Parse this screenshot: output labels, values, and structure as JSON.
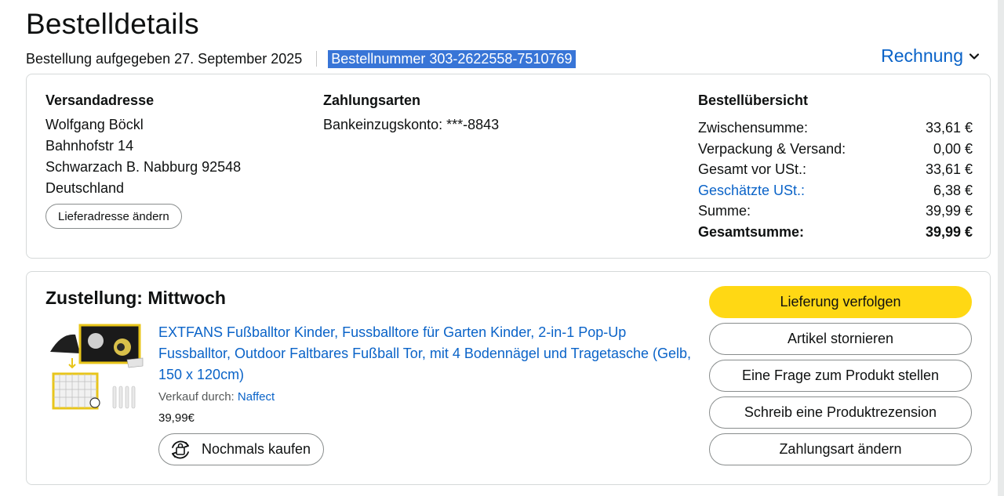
{
  "header": {
    "title": "Bestelldetails",
    "order_placed": "Bestellung aufgegeben 27. September 2025",
    "order_number": "Bestellnummer 303-2622558-7510769",
    "invoice_label": "Rechnung"
  },
  "shipping": {
    "heading": "Versandadresse",
    "lines": [
      "Wolfgang Böckl",
      "Bahnhofstr 14",
      "Schwarzach B. Nabburg 92548",
      "Deutschland"
    ],
    "change_button": "Lieferadresse ändern"
  },
  "payment": {
    "heading": "Zahlungsarten",
    "method": "Bankeinzugskonto: ***-8843"
  },
  "summary": {
    "heading": "Bestellübersicht",
    "rows": [
      {
        "label": "Zwischensumme:",
        "value": "33,61 €"
      },
      {
        "label": "Verpackung & Versand:",
        "value": "0,00 €"
      },
      {
        "label": "Gesamt vor USt.:",
        "value": "33,61 €"
      },
      {
        "label": "Geschätzte USt.:",
        "value": "6,38 €"
      },
      {
        "label": "Summe:",
        "value": "39,99 €"
      }
    ],
    "total": {
      "label": "Gesamtsumme:",
      "value": "39,99 €"
    }
  },
  "delivery": {
    "heading": "Zustellung: Mittwoch",
    "product_title": "EXTFANS Fußballtor Kinder, Fussballtore für Garten Kinder, 2-in-1 Pop-Up Fussballtor, Outdoor Faltbares Fußball Tor, mit 4 Bodennägel und Tragetasche (Gelb, 150 x 120cm)",
    "seller_prefix": "Verkauf durch:",
    "seller_name": "Naffect",
    "price": "39,99€",
    "buy_again": "Nochmals kaufen"
  },
  "actions": {
    "track": "Lieferung verfolgen",
    "cancel": "Artikel stornieren",
    "question": "Eine Frage zum Produkt stellen",
    "review": "Schreib eine Produktrezension",
    "payment_change": "Zahlungsart ändern"
  },
  "colors": {
    "primary_button": "#ffd814",
    "link": "#0a63c8",
    "selection": "#3875d7"
  }
}
